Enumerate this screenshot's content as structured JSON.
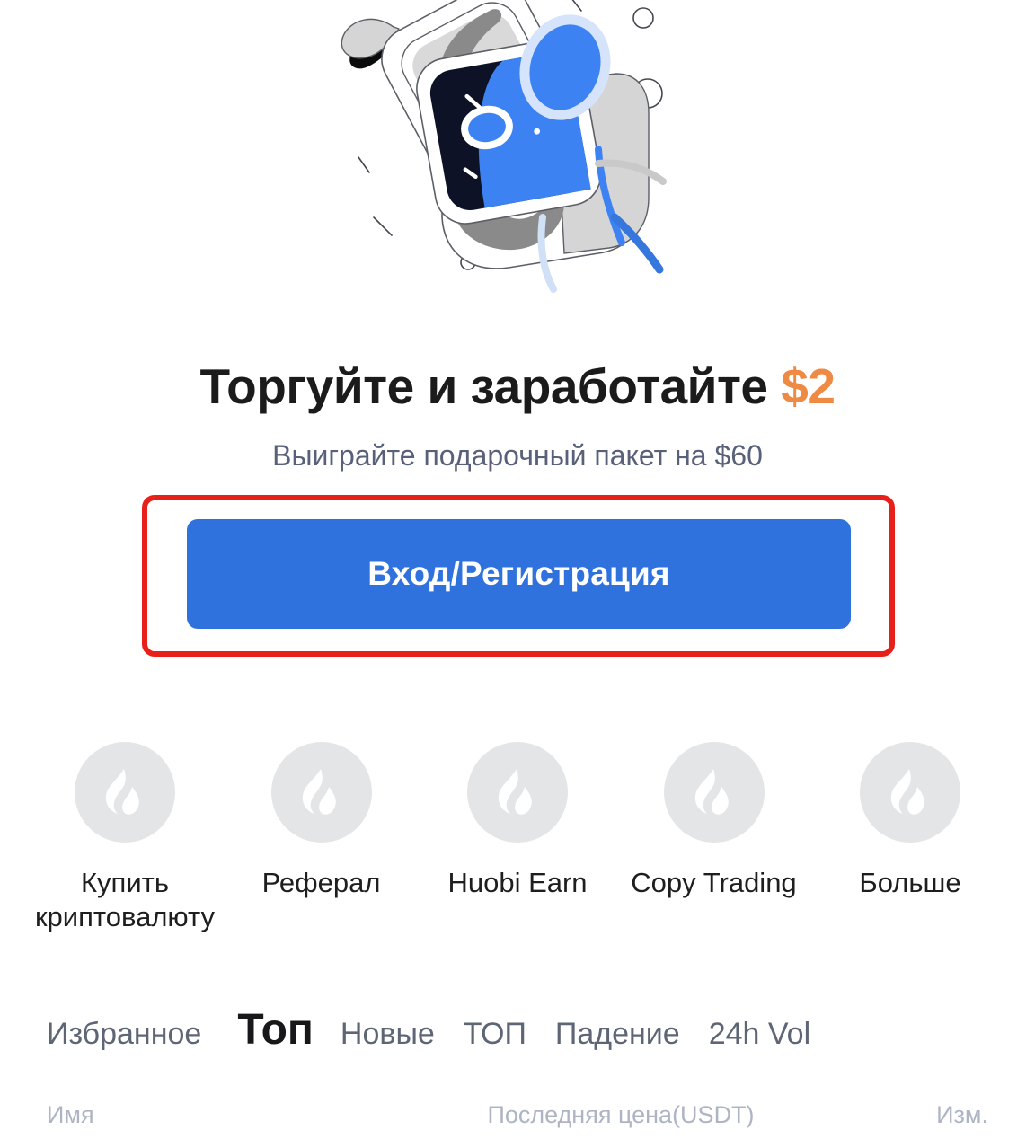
{
  "hero": {
    "illustration_name": "gift-box-illustration",
    "colors": {
      "accent_blue": "#3d82f2",
      "dark_navy": "#0d1227",
      "ribbon_gray": "#d5d5d5",
      "mid_gray": "#8a8a8a"
    }
  },
  "promo": {
    "headline_prefix": "Торгуйте и заработайте ",
    "headline_amount": "$2",
    "subtitle": "Выиграйте подарочный пакет на $60",
    "cta_label": "Вход/Регистрация",
    "cta_color": "#3072dd",
    "highlight_color": "#e8201a",
    "amount_color": "#ee8a43"
  },
  "quick_actions": [
    {
      "label": "Купить криптовалюту",
      "icon": "huobi-flame-icon"
    },
    {
      "label": "Реферал",
      "icon": "huobi-flame-icon"
    },
    {
      "label": "Huobi Earn",
      "icon": "huobi-flame-icon"
    },
    {
      "label": "Copy Trading",
      "icon": "huobi-flame-icon"
    },
    {
      "label": "Больше",
      "icon": "huobi-flame-icon"
    }
  ],
  "market": {
    "tabs": [
      {
        "label": "Избранное",
        "active": false
      },
      {
        "label": "Топ",
        "active": true
      },
      {
        "label": "Новые",
        "active": false
      },
      {
        "label": "ТОП",
        "active": false
      },
      {
        "label": "Падение",
        "active": false
      },
      {
        "label": "24h Vol",
        "active": false
      }
    ],
    "columns": {
      "name": "Имя",
      "price": "Последняя цена(USDT)",
      "change": "Изм."
    }
  }
}
